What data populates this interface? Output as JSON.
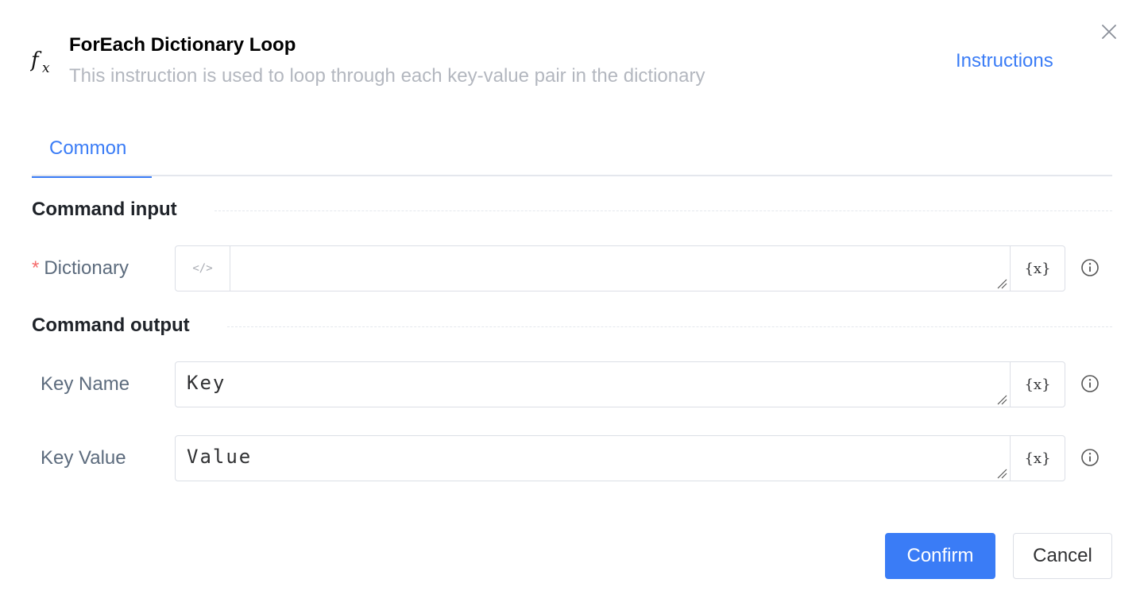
{
  "dialog": {
    "title": "ForEach Dictionary Loop",
    "subtitle": "This instruction is used to loop through each key-value pair in the dictionary",
    "instructions_link": "Instructions",
    "header_icon": "function-fx-icon",
    "close_icon": "close-icon"
  },
  "tabs": [
    {
      "label": "Common",
      "active": true
    }
  ],
  "sections": {
    "input_title": "Command input",
    "output_title": "Command output"
  },
  "fields": {
    "dictionary": {
      "label": "Dictionary",
      "required_mark": "*",
      "value": "",
      "code_toggle": "</>",
      "var_button": "{x}"
    },
    "key_name": {
      "label": "Key Name",
      "value": "Key",
      "var_button": "{x}"
    },
    "key_value": {
      "label": "Key Value",
      "value": "Value",
      "var_button": "{x}"
    }
  },
  "buttons": {
    "confirm": "Confirm",
    "cancel": "Cancel"
  },
  "colors": {
    "accent": "#3a7cf6",
    "required": "#f56c6c",
    "subtitle": "#b3b7bf"
  }
}
